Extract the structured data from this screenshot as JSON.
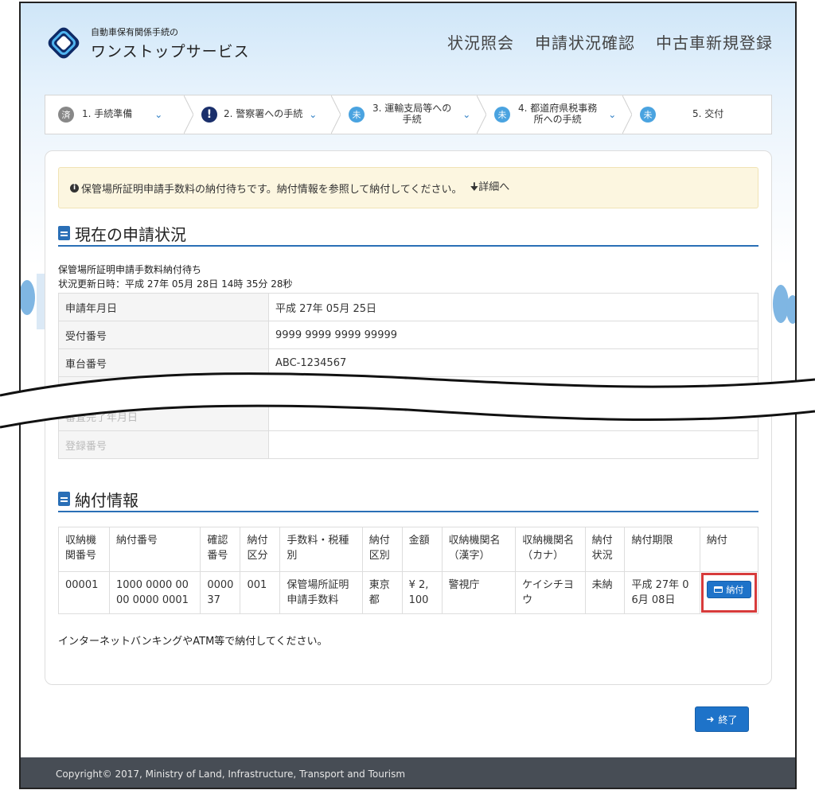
{
  "header": {
    "logo_small": "自動車保有関係手続の",
    "logo_big": "ワンストップサービス",
    "nav": [
      "状況照会",
      "申請状況確認",
      "中古車新規登録"
    ]
  },
  "steps": [
    {
      "badge": "済",
      "label": "1. 手続準備",
      "state": "done"
    },
    {
      "badge": "!",
      "label": "2. 警察署への手続",
      "state": "current"
    },
    {
      "badge": "未",
      "label1": "3. 運輸支局等への",
      "label2": "手続",
      "state": "todo"
    },
    {
      "badge": "未",
      "label1": "4. 都道府県税事務",
      "label2": "所への手続",
      "state": "todo"
    },
    {
      "badge": "未",
      "label": "5. 交付",
      "state": "todo"
    }
  ],
  "alert": {
    "message": "保管場所証明申請手数料の納付待ちです。納付情報を参照して納付してください。",
    "link": "詳細へ"
  },
  "current_status": {
    "title": "現在の申請状況",
    "status": "保管場所証明申請手数料納付待ち",
    "updated": "状況更新日時：平成 27年 05月 28日 14時 35分 28秒",
    "rows": [
      {
        "label": "申請年月日",
        "value": "平成 27年 05月 25日"
      },
      {
        "label": "受付番号",
        "value": "9999 9999 9999 99999"
      },
      {
        "label": "車台番号",
        "value": "ABC-1234567"
      },
      {
        "label": "審査完了年月日",
        "value": ""
      },
      {
        "label": "登録番号",
        "value": ""
      }
    ]
  },
  "payment": {
    "title": "納付情報",
    "headers": [
      "収納機\n関番号",
      "納付番号",
      "確認\n番号",
      "納付\n区分",
      "手数料・税種\n別",
      "納付\n区別",
      "金額",
      "収納機関名\n（漢字）",
      "収納機関名\n（カナ）",
      "納付\n状況",
      "納付期限",
      "納付"
    ],
    "row": [
      "00001",
      "1000 0000 00\n00 0000 0001",
      "0000\n37",
      "001",
      "保管場所証明\n申請手数料",
      "東京\n都",
      "¥ 2,\n100",
      "警視庁",
      "ケイシチヨ\nウ",
      "未納",
      "平成 27年 0\n6月 08日"
    ],
    "pay_button": "納付",
    "note": "インターネットバンキングやATM等で納付してください。"
  },
  "end_button": "終了",
  "footer": "Copyright© 2017, Ministry of Land, Infrastructure, Transport and Tourism",
  "colors": {
    "accent": "#1e73c9",
    "highlight": "#d73b3b",
    "footer": "#474d55",
    "alert_bg": "#fcf6e0"
  }
}
